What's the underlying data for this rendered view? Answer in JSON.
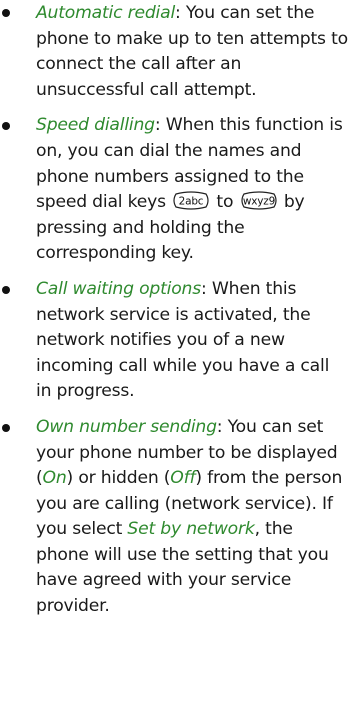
{
  "items": [
    {
      "term": "Automatic redial",
      "desc": ": You can set the phone to make up to ten attempts to connect the call after an unsuccessful call attempt."
    },
    {
      "term": "Speed dialling",
      "desc_before": ": When this function is on, you can dial the names and phone numbers assigned to the speed dial keys",
      "key_start": "2abc",
      "between": "to",
      "key_end": "wxyz9",
      "desc_after": "by pressing and holding the corresponding key."
    },
    {
      "term": "Call waiting options",
      "desc": ": When this network service is activated, the network notifies you of a new incoming call while you have a call in progress."
    },
    {
      "term": "Own number sending",
      "desc_a": ": You can set your phone number to be displayed (",
      "on": "On",
      "desc_b": ") or hidden (",
      "off": "Off",
      "desc_c": ") from the person you are calling (network service). If you select",
      "set_by_network": "Set by network",
      "desc_d": ", the phone will use the setting that you have agreed with your service provider."
    }
  ],
  "icons": {
    "key_start": "key-2abc-icon",
    "key_end": "key-wxyz9-icon"
  },
  "colors": {
    "term": "#2f8a2f",
    "text": "#1a1a1a",
    "bullet": "#111111"
  }
}
